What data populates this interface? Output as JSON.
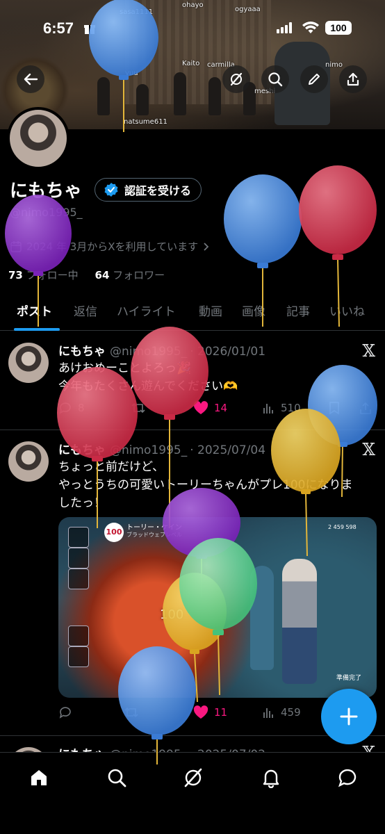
{
  "status_bar": {
    "time": "6:57",
    "battery": "100"
  },
  "banner": {
    "names": [
      "sasa1111",
      "ohayo",
      "ogyaaa",
      "yuu",
      "Kaito",
      "carmilla",
      "nimo",
      "meshi",
      "natsume611"
    ]
  },
  "profile": {
    "display_name": "にもちゃ",
    "verify_label": "認証を受ける",
    "handle": "@nimo1995_",
    "joined": "2024 年 3月からXを利用しています",
    "following_count": "73",
    "following_label": "フォロー中",
    "followers_count": "64",
    "followers_label": "フォロワー"
  },
  "tabs": [
    "ポスト",
    "返信",
    "ハイライト",
    "動画",
    "画像",
    "記事",
    "いいね"
  ],
  "posts": [
    {
      "name": "にもちゃ",
      "handle": "@nimo1995_",
      "date": "· 2026/01/01",
      "lines": [
        "あけおめーことよろっ🎉",
        "今年もたくさん遊んでください🫶"
      ],
      "replies": "8",
      "likes": "14",
      "views": "510"
    },
    {
      "name": "にもちゃ",
      "handle": "@nimo1995_",
      "date": "· 2025/07/04",
      "lines": [
        "ちょっと前だけど、",
        "やっとうちの可愛いトーリーちゃんがプレ100になりま",
        "したっ！"
      ],
      "likes": "11",
      "views": "459",
      "media": {
        "badge": "100",
        "title": "トーリー・ケイン",
        "subtitle": "ブラッドウェブレベル",
        "top_right": "2 459 598",
        "bottom_right": "準備完了",
        "big_number": "100"
      }
    },
    {
      "name": "にもちゃ",
      "handle": "@nimo1995_",
      "date": "· 2025/07/02"
    }
  ],
  "balloon_colors": {
    "blue": "#4a8fe0",
    "red": "#d63a52",
    "purple": "#8a2fc7",
    "yellow": "#e7b92c",
    "green": "#5fd192"
  },
  "accent": "#1d9bf0",
  "like_color": "#f91880"
}
